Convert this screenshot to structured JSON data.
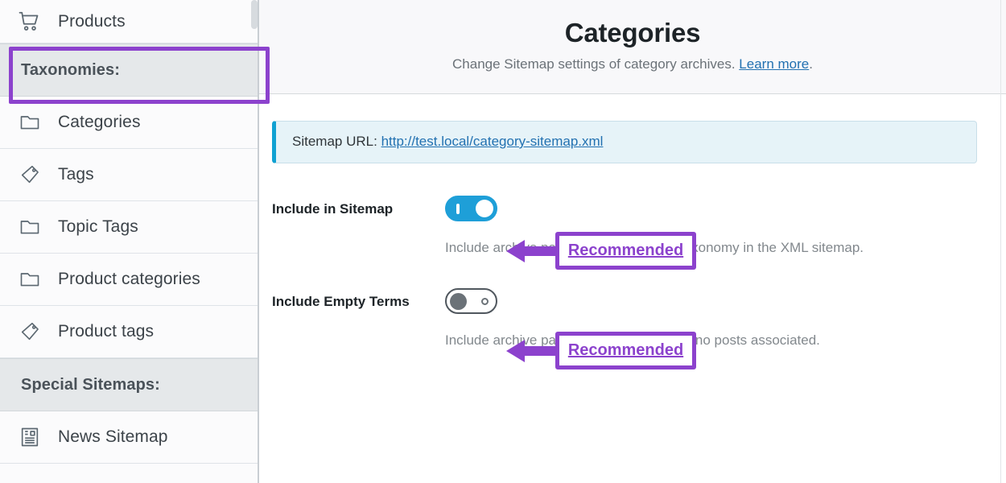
{
  "sidebar": {
    "items": [
      {
        "label": "Products",
        "icon": "cart-icon",
        "type": "item",
        "key": "products"
      },
      {
        "label": "Taxonomies:",
        "icon": "none",
        "type": "heading",
        "key": "taxonomies"
      },
      {
        "label": "Categories",
        "icon": "folder-icon",
        "type": "item",
        "key": "categories"
      },
      {
        "label": "Tags",
        "icon": "tag-icon",
        "type": "item",
        "key": "tags"
      },
      {
        "label": "Topic Tags",
        "icon": "folder-icon",
        "type": "item",
        "key": "topic-tags"
      },
      {
        "label": "Product categories",
        "icon": "folder-icon",
        "type": "item",
        "key": "product-categories"
      },
      {
        "label": "Product tags",
        "icon": "tag-icon",
        "type": "item",
        "key": "product-tags"
      },
      {
        "label": "Special Sitemaps:",
        "icon": "none",
        "type": "heading",
        "key": "special-sitemaps"
      },
      {
        "label": "News Sitemap",
        "icon": "newspaper-icon",
        "type": "item",
        "key": "news-sitemap"
      }
    ]
  },
  "panel": {
    "title": "Categories",
    "subtitle_text": "Change Sitemap settings of category archives.",
    "subtitle_link": "Learn more",
    "subtitle_period": "."
  },
  "notice": {
    "label": "Sitemap URL:",
    "url": "http://test.local/category-sitemap.xml"
  },
  "settings": [
    {
      "label": "Include in Sitemap",
      "state": "on",
      "description": "Include archive pages for terms of this taxonomy in the XML sitemap."
    },
    {
      "label": "Include Empty Terms",
      "state": "off",
      "description": "Include archive pages of terms that have no posts associated."
    }
  ],
  "annotations": {
    "recommended_label": "Recommended",
    "accent_color": "#8c42cd"
  },
  "colors": {
    "toggle_on": "#1e9fd8",
    "toggle_off_border": "#50575e",
    "link": "#2271b1",
    "notice_bg": "#e6f3f8",
    "notice_accent": "#10a1d2"
  }
}
